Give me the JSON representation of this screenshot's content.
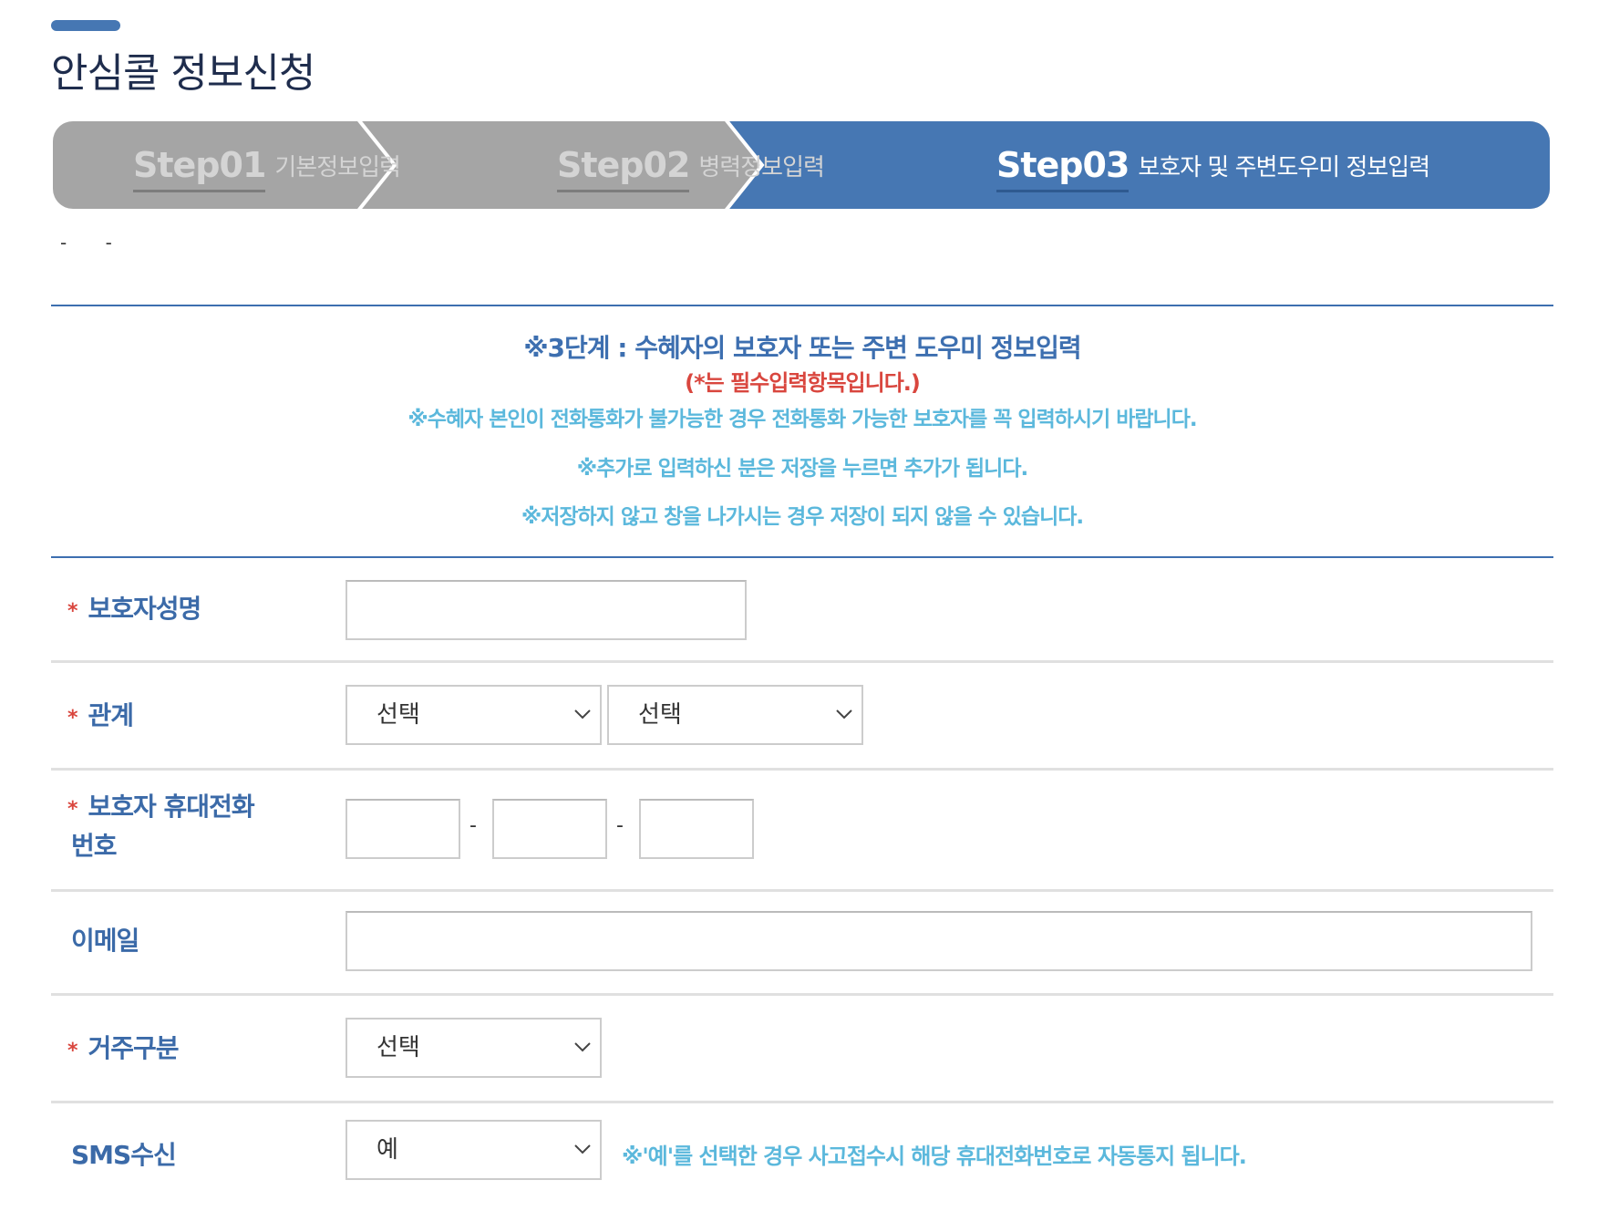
{
  "page": {
    "title": "안심콜 정보신청",
    "dashes": "- -"
  },
  "steps": [
    {
      "num": "Step01",
      "label": "기본정보입력",
      "active": false
    },
    {
      "num": "Step02",
      "label": "병력정보입력",
      "active": false
    },
    {
      "num": "Step03",
      "label": "보호자 및 주변도우미 정보입력",
      "active": true
    }
  ],
  "colors": {
    "accent": "#4677b3",
    "inactive_step": "#a5a5a5",
    "required": "#d9463e",
    "hint": "#5bb8dc"
  },
  "notice": {
    "heading": "※3단계 : 수혜자의 보호자 또는 주변 도우미 정보입력",
    "required_note": "(*는 필수입력항목입니다.)",
    "lines": [
      "※수혜자 본인이 전화통화가 불가능한 경우 전화통화 가능한 보호자를 꼭 입력하시기 바랍니다.",
      "※추가로 입력하신 분은 저장을 누르면 추가가 됩니다.",
      "※저장하지 않고 창을 나가시는 경우 저장이 되지 않을 수 있습니다."
    ]
  },
  "form": {
    "required_mark": "*",
    "guardian_name": {
      "label": "보호자성명",
      "value": ""
    },
    "relation": {
      "label": "관계",
      "select1": "선택",
      "select2": "선택"
    },
    "phone": {
      "label_line1": "보호자 휴대전화",
      "label_line2": "번호",
      "separator": "-",
      "parts": [
        "",
        "",
        ""
      ]
    },
    "email": {
      "label": "이메일",
      "value": ""
    },
    "residence": {
      "label": "거주구분",
      "select": "선택"
    },
    "sms": {
      "label": "SMS수신",
      "select": "예",
      "note": "※'예'를 선택한 경우 사고접수시 해당 휴대전화번호로 자동통지 됩니다."
    }
  }
}
